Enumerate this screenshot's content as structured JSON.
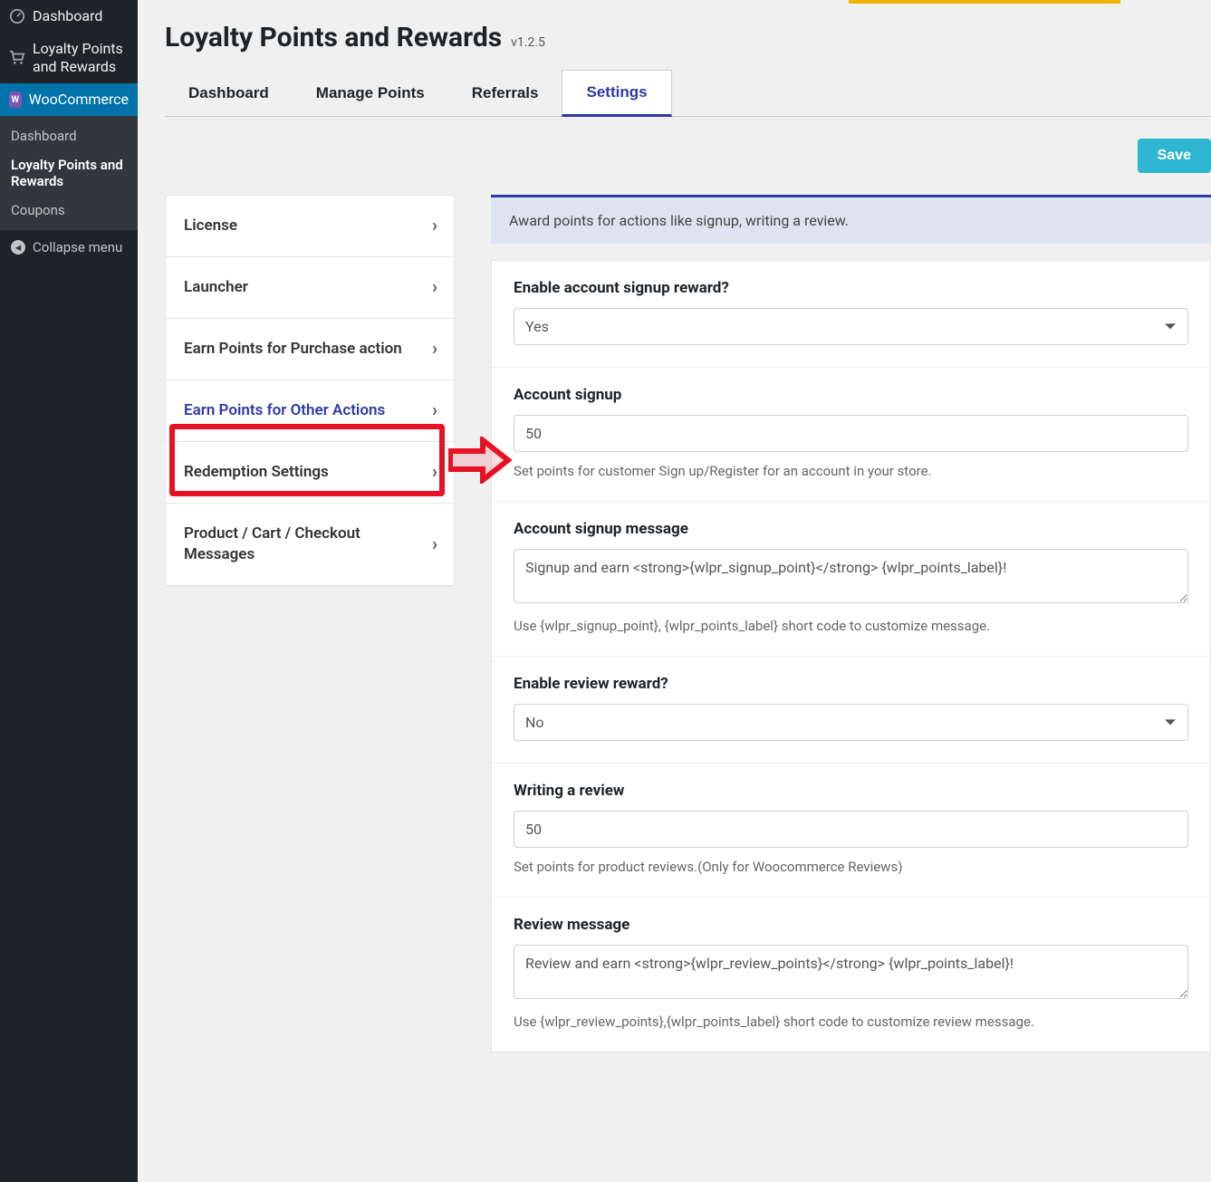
{
  "sidebar": {
    "items": [
      {
        "label": "Dashboard",
        "icon": "dashboard-icon"
      },
      {
        "label": "Loyalty Points and Rewards",
        "icon": "cart-icon"
      },
      {
        "label": "WooCommerce",
        "icon": "woo-icon",
        "current": true
      }
    ],
    "submenu": [
      {
        "label": "Dashboard"
      },
      {
        "label": "Loyalty Points and Rewards",
        "active": true
      },
      {
        "label": "Coupons"
      }
    ],
    "collapse_label": "Collapse menu"
  },
  "header": {
    "title": "Loyalty Points and Rewards",
    "version": "v1.2.5"
  },
  "tabs": [
    {
      "label": "Dashboard"
    },
    {
      "label": "Manage Points"
    },
    {
      "label": "Referrals"
    },
    {
      "label": "Settings",
      "active": true
    }
  ],
  "save_button": "Save",
  "settings_nav": [
    {
      "label": "License"
    },
    {
      "label": "Launcher"
    },
    {
      "label": "Earn Points for Purchase action"
    },
    {
      "label": "Earn Points for Other Actions",
      "active": true,
      "highlighted": true
    },
    {
      "label": "Redemption Settings"
    },
    {
      "label": "Product / Cart / Checkout Messages"
    }
  ],
  "info_bar": "Award points for actions like signup, writing a review.",
  "form": {
    "enable_signup_label": "Enable account signup reward?",
    "enable_signup_value": "Yes",
    "account_signup_label": "Account signup",
    "account_signup_value": "50",
    "account_signup_help": "Set points for customer Sign up/Register for an account in your store.",
    "signup_message_label": "Account signup message",
    "signup_message_value": "Signup and earn <strong>{wlpr_signup_point}</strong> {wlpr_points_label}!",
    "signup_message_help": "Use {wlpr_signup_point}, {wlpr_points_label} short code to customize message.",
    "enable_review_label": "Enable review reward?",
    "enable_review_value": "No",
    "writing_review_label": "Writing a review",
    "writing_review_value": "50",
    "writing_review_help": "Set points for product reviews.(Only for Woocommerce Reviews)",
    "review_message_label": "Review message",
    "review_message_value": "Review and earn <strong>{wlpr_review_points}</strong> {wlpr_points_label}!",
    "review_message_help": "Use {wlpr_review_points},{wlpr_points_label} short code to customize review message."
  }
}
